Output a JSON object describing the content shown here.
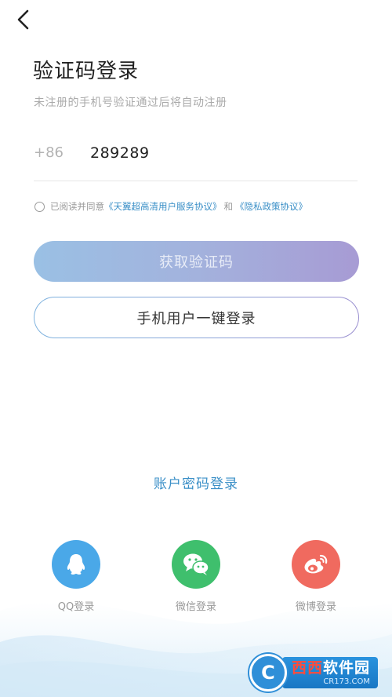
{
  "header": {
    "title": "验证码登录",
    "subtitle": "未注册的手机号验证通过后将自动注册"
  },
  "phone": {
    "country_code": "+86",
    "value": "289289"
  },
  "agreement": {
    "prefix": "已阅读并同意",
    "service_link": "《天翼超高清用户服务协议》",
    "and": "和",
    "privacy_link": "《隐私政策协议》",
    "checked": false
  },
  "buttons": {
    "get_code": "获取验证码",
    "one_key_login": "手机用户一键登录"
  },
  "password_login": "账户密码登录",
  "social": [
    {
      "label": "QQ登录",
      "icon": "qq-icon",
      "color": "#4aa8e8"
    },
    {
      "label": "微信登录",
      "icon": "wechat-icon",
      "color": "#3fbf6d"
    },
    {
      "label": "微博登录",
      "icon": "weibo-icon",
      "color": "#f06a5f"
    }
  ],
  "watermark": {
    "badge": "C",
    "name_red": "西西",
    "name_rest": "软件园",
    "url": "CR173.COM"
  },
  "colors": {
    "link": "#3a8fc7",
    "button_gradient_start": "#9ac0e4",
    "button_gradient_end": "#a79bd4"
  }
}
